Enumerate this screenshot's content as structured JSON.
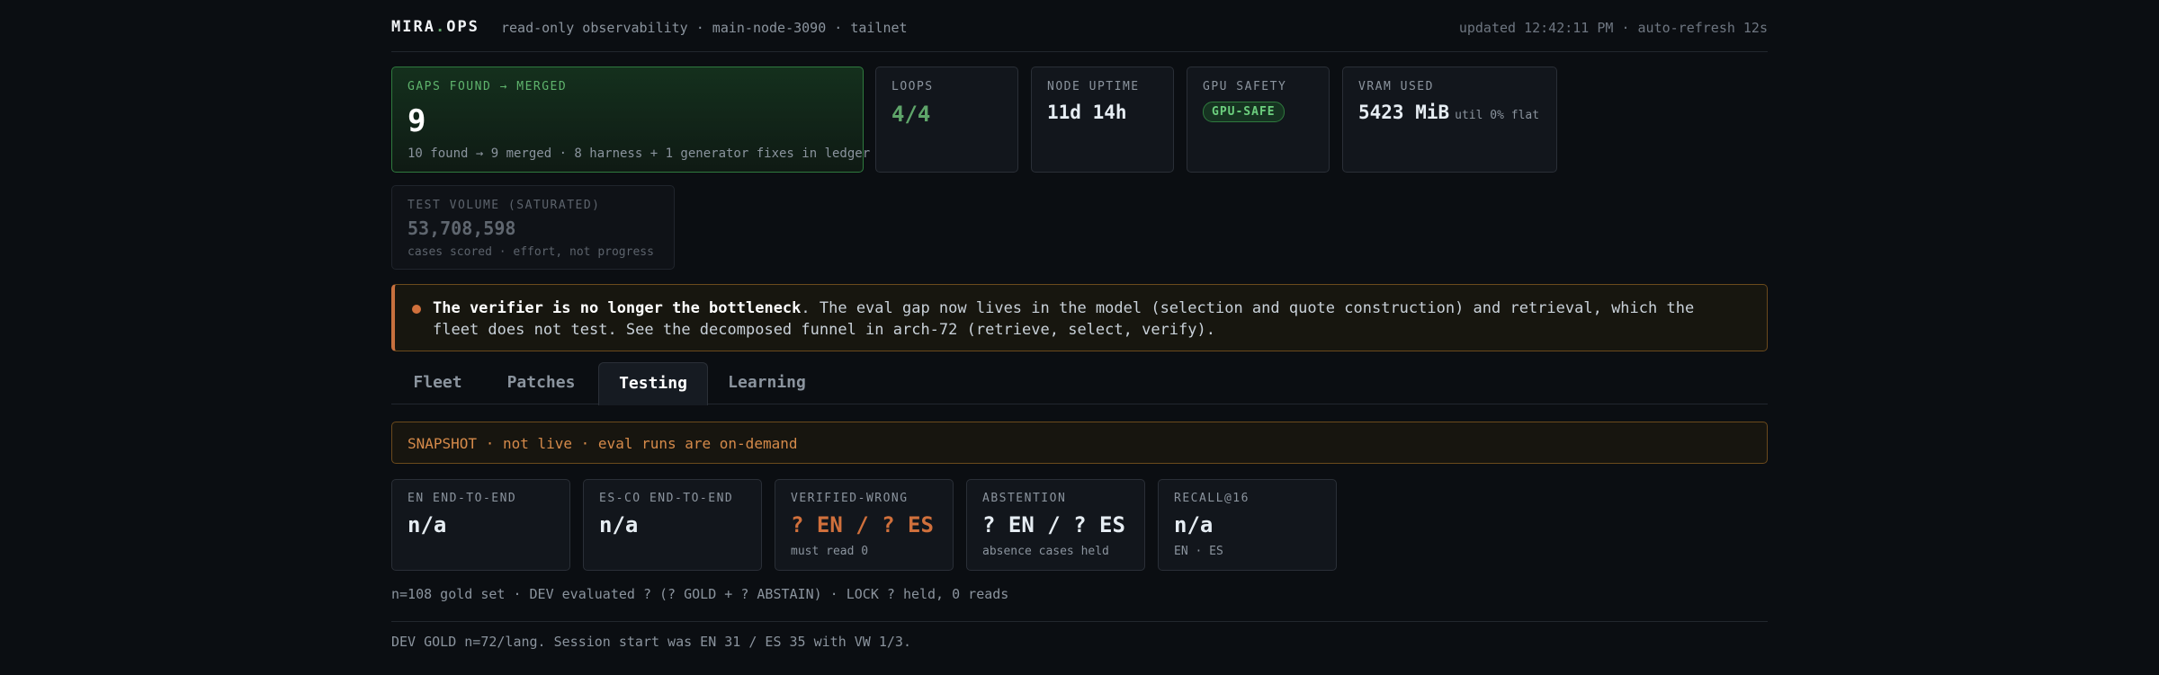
{
  "header": {
    "brand_main": "MIRA",
    "brand_dot": ".",
    "brand_suffix": "OPS",
    "subtitle": "read-only observability · main-node-3090 · tailnet",
    "updated": "updated 12:42:11 PM · auto-refresh 12s"
  },
  "cards": {
    "gaps": {
      "label": "GAPS FOUND → MERGED",
      "value": "9",
      "sub": "10 found → 9 merged · 8 harness + 1 generator fixes in ledger"
    },
    "loops": {
      "label": "LOOPS",
      "value": "4/4"
    },
    "uptime": {
      "label": "NODE UPTIME",
      "value": "11d 14h"
    },
    "gpu": {
      "label": "GPU SAFETY",
      "badge": "GPU-SAFE"
    },
    "vram": {
      "label": "VRAM USED",
      "value": "5423 MiB",
      "note": "util 0% flat"
    },
    "volume": {
      "label": "TEST VOLUME (SATURATED)",
      "value": "53,708,598",
      "sub": "cases scored · effort, not progress"
    }
  },
  "alert": {
    "bold": "The verifier is no longer the bottleneck",
    "text": ". The eval gap now lives in the model (selection and quote construction) and retrieval, which the fleet does not test. See the decomposed funnel in arch-72 (retrieve, select, verify)."
  },
  "tabs": [
    {
      "label": "Fleet",
      "active": false
    },
    {
      "label": "Patches",
      "active": false
    },
    {
      "label": "Testing",
      "active": true
    },
    {
      "label": "Learning",
      "active": false
    }
  ],
  "snapshot": "SNAPSHOT · not live · eval runs are on-demand",
  "metrics": [
    {
      "label": "EN END-TO-END",
      "value": "n/a",
      "sub": ""
    },
    {
      "label": "ES-CO END-TO-END",
      "value": "n/a",
      "sub": ""
    },
    {
      "label": "VERIFIED-WRONG",
      "value": "? EN / ? ES",
      "sub": "must read 0"
    },
    {
      "label": "ABSTENTION",
      "value": "? EN / ? ES",
      "sub": "absence cases held"
    },
    {
      "label": "RECALL@16",
      "value": "n/a",
      "sub": "EN · ES"
    }
  ],
  "footline": "n=108 gold set · DEV evaluated ? (? GOLD + ? ABSTAIN) · LOCK ? held, 0 reads",
  "footnote": "DEV GOLD n=72/lang. Session start was EN 31 / ES 35 with VW 1/3.",
  "colors": {
    "accent_green": "#5fa56a",
    "warn_orange": "#d0703c",
    "background": "#0b0e12"
  }
}
